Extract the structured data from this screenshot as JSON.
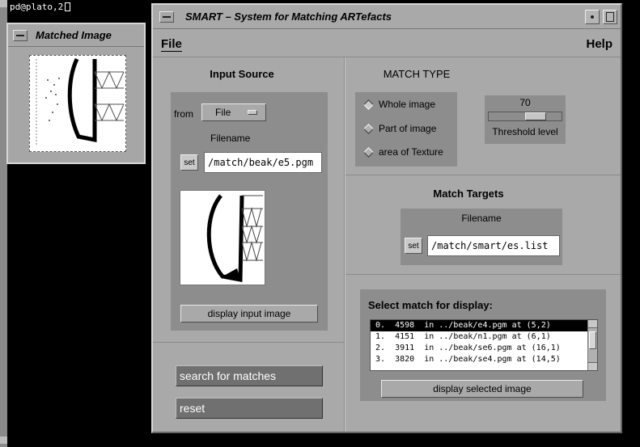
{
  "terminal": {
    "title": "pd@plato,2"
  },
  "matched_window": {
    "title": "Matched Image"
  },
  "main_window": {
    "title": "SMART – System for Matching ARTefacts"
  },
  "menu": {
    "file": "File",
    "help": "Help"
  },
  "input_source": {
    "heading": "Input Source",
    "from_label": "from",
    "from_option": "File",
    "filename_label": "Filename",
    "set_label": "set",
    "filename_value": "/match/beak/e5.pgm",
    "display_button": "display input image"
  },
  "match_type": {
    "heading": "MATCH TYPE",
    "options": [
      "Whole image",
      "Part of image",
      "area of Texture"
    ],
    "selected": "Whole image",
    "threshold_value": "70",
    "threshold_label": "Threshold level",
    "threshold_fraction": 0.7
  },
  "match_targets": {
    "heading": "Match Targets",
    "filename_label": "Filename",
    "set_label": "set",
    "filename_value": "/match/smart/es.list"
  },
  "results": {
    "heading": "Select match for display:",
    "rows": [
      "0.  4598  in ../beak/e4.pgm at (5,2)",
      "1.  4151  in ../beak/n1.pgm at (6,1)",
      "2.  3911  in ../beak/se6.pgm at (16,1)",
      "3.  3820  in ../beak/se4.pgm at (14,5)"
    ],
    "selected_index": 0,
    "display_button": "display selected image"
  },
  "actions": {
    "search": "search for matches",
    "reset": "reset"
  }
}
